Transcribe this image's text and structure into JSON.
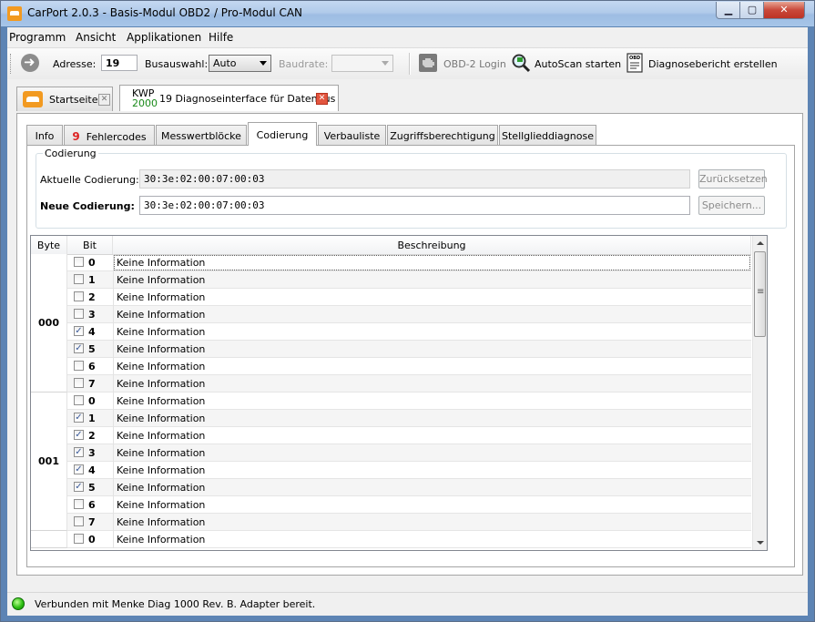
{
  "window": {
    "title": "CarPort 2.0.3  - Basis-Modul OBD2 / Pro-Modul CAN"
  },
  "menu": [
    {
      "label": "Programm"
    },
    {
      "label": "Ansicht"
    },
    {
      "label": "Applikationen"
    },
    {
      "label": "Hilfe"
    }
  ],
  "toolbar": {
    "address_label": "Adresse:",
    "address_value": "19",
    "bus_label": "Busauswahl:",
    "bus_value": "Auto",
    "baud_label": "Baudrate:",
    "baud_value": "",
    "obd_login": "OBD-2 Login",
    "autoscan": "AutoScan starten",
    "report": "Diagnosebericht erstellen"
  },
  "doc_tabs": {
    "start": "Startseite",
    "protocol_top": "KWP",
    "protocol_bottom": "2000",
    "module": "19 Diagnoseinterface für Datenbus"
  },
  "inner_tabs": [
    {
      "label": "Info"
    },
    {
      "count": "9",
      "label": "Fehlercodes"
    },
    {
      "label": "Messwertblöcke"
    },
    {
      "label": "Codierung"
    },
    {
      "label": "Verbauliste"
    },
    {
      "label": "Zugriffsberechtigung"
    },
    {
      "label": "Stellglieddiagnose"
    }
  ],
  "coding": {
    "group_title": "Codierung",
    "current_label": "Aktuelle Codierung:",
    "current_value": "30:3e:02:00:07:00:03",
    "new_label": "Neue Codierung:",
    "new_value": "30:3e:02:00:07:00:03",
    "reset_button": "Zurücksetzen",
    "save_button": "Speichern..."
  },
  "grid": {
    "headers": {
      "byte": "Byte",
      "bit": "Bit",
      "description": "Beschreibung"
    },
    "bytes": [
      {
        "byte": "000",
        "bits": [
          {
            "bit": "0",
            "checked": false,
            "desc": "Keine Information"
          },
          {
            "bit": "1",
            "checked": false,
            "desc": "Keine Information"
          },
          {
            "bit": "2",
            "checked": false,
            "desc": "Keine Information"
          },
          {
            "bit": "3",
            "checked": false,
            "desc": "Keine Information"
          },
          {
            "bit": "4",
            "checked": true,
            "desc": "Keine Information"
          },
          {
            "bit": "5",
            "checked": true,
            "desc": "Keine Information"
          },
          {
            "bit": "6",
            "checked": false,
            "desc": "Keine Information"
          },
          {
            "bit": "7",
            "checked": false,
            "desc": "Keine Information"
          }
        ]
      },
      {
        "byte": "001",
        "bits": [
          {
            "bit": "0",
            "checked": false,
            "desc": "Keine Information"
          },
          {
            "bit": "1",
            "checked": true,
            "desc": "Keine Information"
          },
          {
            "bit": "2",
            "checked": true,
            "desc": "Keine Information"
          },
          {
            "bit": "3",
            "checked": true,
            "desc": "Keine Information"
          },
          {
            "bit": "4",
            "checked": true,
            "desc": "Keine Information"
          },
          {
            "bit": "5",
            "checked": true,
            "desc": "Keine Information"
          },
          {
            "bit": "6",
            "checked": false,
            "desc": "Keine Information"
          },
          {
            "bit": "7",
            "checked": false,
            "desc": "Keine Information"
          }
        ]
      },
      {
        "byte": "",
        "bits": [
          {
            "bit": "0",
            "checked": false,
            "desc": "Keine Information"
          }
        ]
      }
    ]
  },
  "status": {
    "text": "Verbunden mit Menke Diag 1000 Rev. B. Adapter bereit.",
    "led_color": "#2fbf14"
  }
}
